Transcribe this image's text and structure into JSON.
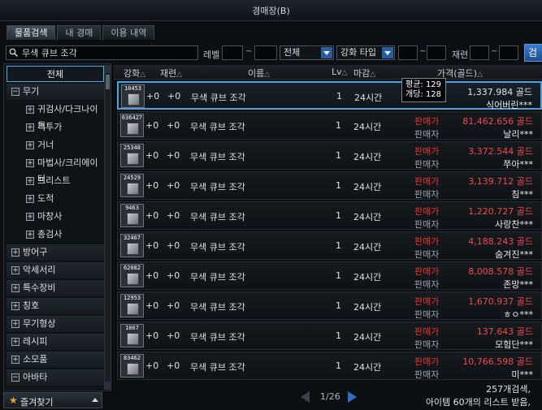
{
  "window": {
    "title": "경매장(B)"
  },
  "tabs": [
    {
      "label": "물품검색",
      "active": true
    },
    {
      "label": "내 경매",
      "active": false
    },
    {
      "label": "이용 내역",
      "active": false
    }
  ],
  "search": {
    "query": "무색 큐브 조각",
    "level_label": "레벨",
    "tilde": "~",
    "category_select": "전체",
    "enhance_select": "강화 타입",
    "refine_label": "재련",
    "button": "검"
  },
  "sidebar": {
    "items": [
      {
        "label": "전체",
        "type": "all"
      },
      {
        "label": "무기",
        "type": "top",
        "sign": "−"
      },
      {
        "label": "귀검사/다크나이트",
        "type": "sub",
        "sign": "+"
      },
      {
        "label": "격투가",
        "type": "sub",
        "sign": "+"
      },
      {
        "label": "거너",
        "type": "sub",
        "sign": "+"
      },
      {
        "label": "마법사/크리에이터",
        "type": "sub",
        "sign": "+"
      },
      {
        "label": "프리스트",
        "type": "sub",
        "sign": "+"
      },
      {
        "label": "도적",
        "type": "sub",
        "sign": "+"
      },
      {
        "label": "마창사",
        "type": "sub",
        "sign": "+"
      },
      {
        "label": "총검사",
        "type": "sub",
        "sign": "+"
      },
      {
        "label": "방어구",
        "type": "top",
        "sign": "+"
      },
      {
        "label": "악세서리",
        "type": "top",
        "sign": "+"
      },
      {
        "label": "특수장비",
        "type": "top",
        "sign": "+"
      },
      {
        "label": "칭호",
        "type": "top",
        "sign": "+"
      },
      {
        "label": "무기형상",
        "type": "top",
        "sign": "+"
      },
      {
        "label": "레시피",
        "type": "top",
        "sign": "+"
      },
      {
        "label": "소모품",
        "type": "top",
        "sign": "+"
      },
      {
        "label": "아바타",
        "type": "top",
        "sign": "−"
      }
    ],
    "favorites": "즐겨찾기"
  },
  "table": {
    "headers": {
      "enhance": "강화",
      "refine": "재련",
      "name": "이름",
      "level": "Lv",
      "deadline": "마감",
      "price": "가격(골드)"
    },
    "sort_glyph": "△",
    "seller_label": "판매가",
    "seller_sub": "판매자",
    "rows": [
      {
        "count": "10453",
        "enhance": "+0",
        "refine": "+0",
        "name": "무색 큐브 조각",
        "level": "1",
        "deadline": "24시간",
        "price": "1,337.984 골드",
        "seller": "식어버린***",
        "selected": true
      },
      {
        "count": "636427",
        "enhance": "+0",
        "refine": "+0",
        "name": "무색 큐브 조각",
        "level": "1",
        "deadline": "24시간",
        "price": "81,462.656 골드",
        "seller": "날리***"
      },
      {
        "count": "25348",
        "enhance": "+0",
        "refine": "+0",
        "name": "무색 큐브 조각",
        "level": "1",
        "deadline": "24시간",
        "price": "3,372.544 골드",
        "seller": "쭈아***"
      },
      {
        "count": "24529",
        "enhance": "+0",
        "refine": "+0",
        "name": "무색 큐브 조각",
        "level": "1",
        "deadline": "24시간",
        "price": "3,139.712 골드",
        "seller": "침***"
      },
      {
        "count": "9463",
        "enhance": "+0",
        "refine": "+0",
        "name": "무색 큐브 조각",
        "level": "1",
        "deadline": "24시간",
        "price": "1,220.727 골드",
        "seller": "사랑찬***"
      },
      {
        "count": "32467",
        "enhance": "+0",
        "refine": "+0",
        "name": "무색 큐브 조각",
        "level": "1",
        "deadline": "24시간",
        "price": "4,188.243 골드",
        "seller": "숨겨진***"
      },
      {
        "count": "62082",
        "enhance": "+0",
        "refine": "+0",
        "name": "무색 큐브 조각",
        "level": "1",
        "deadline": "24시간",
        "price": "8,008.578 골드",
        "seller": "존망***"
      },
      {
        "count": "12953",
        "enhance": "+0",
        "refine": "+0",
        "name": "무색 큐브 조각",
        "level": "1",
        "deadline": "24시간",
        "price": "1,670.937 골드",
        "seller": "ㅎㅇ***"
      },
      {
        "count": "1067",
        "enhance": "+0",
        "refine": "+0",
        "name": "무색 큐브 조각",
        "level": "1",
        "deadline": "24시간",
        "price": "137.643 골드",
        "seller": "모험단***"
      },
      {
        "count": "83462",
        "enhance": "+0",
        "refine": "+0",
        "name": "무색 큐브 조각",
        "level": "1",
        "deadline": "24시간",
        "price": "10,766.598 골드",
        "seller": "미***"
      }
    ]
  },
  "tooltip": {
    "avg": "평균: 129",
    "unit": "개당: 128"
  },
  "pager": {
    "page": "1/26"
  },
  "status": {
    "line1": "257개검색,",
    "line2": "아이템 60개의 리스트 받음,"
  }
}
